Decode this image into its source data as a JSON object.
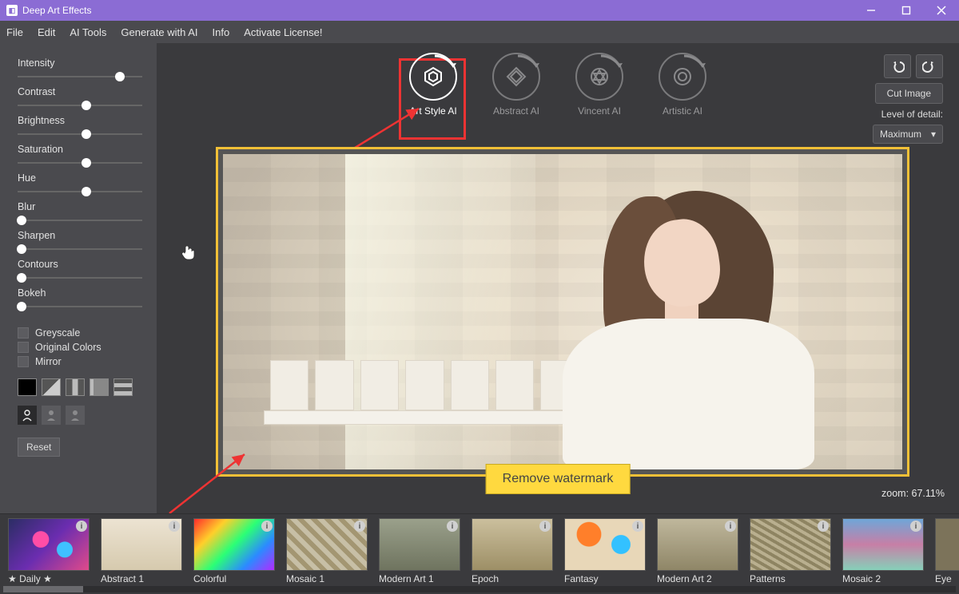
{
  "app_title": "Deep Art Effects",
  "menu": [
    "File",
    "Edit",
    "AI Tools",
    "Generate with AI",
    "Info",
    "Activate License!"
  ],
  "sidebar": {
    "sliders": [
      {
        "label": "Intensity",
        "pos": 0.82
      },
      {
        "label": "Contrast",
        "pos": 0.55
      },
      {
        "label": "Brightness",
        "pos": 0.55
      },
      {
        "label": "Saturation",
        "pos": 0.55
      },
      {
        "label": "Hue",
        "pos": 0.55
      },
      {
        "label": "Blur",
        "pos": 0.03
      },
      {
        "label": "Sharpen",
        "pos": 0.03
      },
      {
        "label": "Contours",
        "pos": 0.03
      },
      {
        "label": "Bokeh",
        "pos": 0.03
      }
    ],
    "checkboxes": [
      "Greyscale",
      "Original Colors",
      "Mirror"
    ],
    "reset_label": "Reset"
  },
  "ai_modes": [
    {
      "label": "Art Style AI",
      "selected": true
    },
    {
      "label": "Abstract AI",
      "selected": false
    },
    {
      "label": "Vincent AI",
      "selected": false
    },
    {
      "label": "Artistic AI",
      "selected": false
    }
  ],
  "right_controls": {
    "cut_label": "Cut Image",
    "lod_label": "Level of detail:",
    "lod_value": "Maximum"
  },
  "watermark_button": "Remove watermark",
  "zoom_text": "zoom: 67.11%",
  "thumbnails": [
    {
      "label": "★ Daily ★"
    },
    {
      "label": "Abstract 1"
    },
    {
      "label": "Colorful"
    },
    {
      "label": "Mosaic 1"
    },
    {
      "label": "Modern Art 1"
    },
    {
      "label": "Epoch"
    },
    {
      "label": "Fantasy"
    },
    {
      "label": "Modern Art 2"
    },
    {
      "label": "Patterns"
    },
    {
      "label": "Mosaic 2"
    },
    {
      "label": "Eye"
    }
  ]
}
